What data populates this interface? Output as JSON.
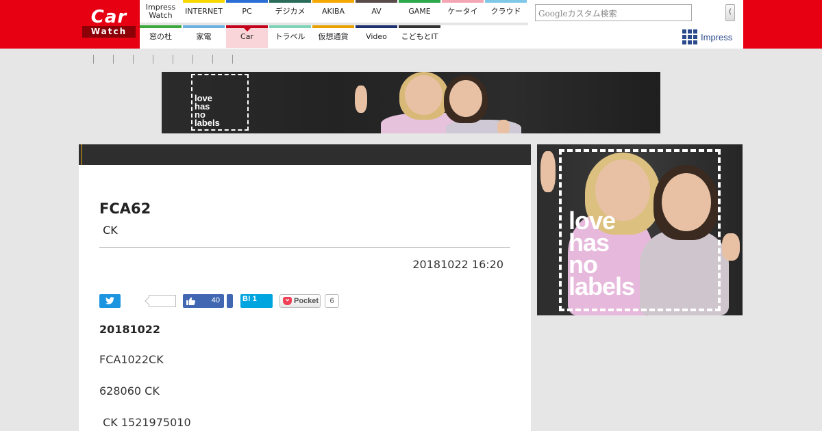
{
  "logo": {
    "car": "Car",
    "watch": "Watch"
  },
  "nav": {
    "row1": [
      {
        "label": "Impress\nWatch",
        "color": ""
      },
      {
        "label": "INTERNET",
        "color": "#f7d900"
      },
      {
        "label": "PC",
        "color": "#2b6fd6"
      },
      {
        "label": "デジカメ",
        "color": "#2a6b5a"
      },
      {
        "label": "AKIBA",
        "color": "#f5a800"
      },
      {
        "label": "AV",
        "color": "#5a4b4b"
      },
      {
        "label": "GAME",
        "color": "#2aa84a"
      },
      {
        "label": "ケータイ",
        "color": "#f4a6b4"
      },
      {
        "label": "クラウド",
        "color": "#7fc8e8"
      }
    ],
    "row2": [
      {
        "label": "窓の杜",
        "color": "#3aa83a"
      },
      {
        "label": "家電",
        "color": "#6ab0e0"
      },
      {
        "label": "Car",
        "color": "#c3001a",
        "active": true
      },
      {
        "label": "トラベル",
        "color": "#7dd4b8"
      },
      {
        "label": "仮想通貨",
        "color": "#e8a000"
      },
      {
        "label": "Video",
        "color": "#1c2f6e"
      },
      {
        "label": "こどもとIT",
        "color": "#333333"
      }
    ]
  },
  "search": {
    "placeholder": "Googleカスタム検索",
    "button": "("
  },
  "impress": {
    "label": "Impress"
  },
  "banner_ad": {
    "text_lines": [
      "love",
      "has",
      "no",
      "labels"
    ]
  },
  "side_ad": {
    "text_lines": [
      "love",
      "has",
      "no",
      "labels"
    ]
  },
  "article": {
    "title": "FCA62",
    "subtitle": " CK",
    "date": "20181022 16:20",
    "social": {
      "facebook_count": "40",
      "hatena_label": "B!",
      "hatena_count": "1",
      "pocket_label": "Pocket",
      "pocket_count": "6"
    },
    "heading": "20181022",
    "paragraphs": [
      "FCA1022CK",
      "628060 CK",
      " CK 1521975010"
    ]
  },
  "colors": {
    "brand_red": "#e60012",
    "twitter": "#1b95e0",
    "facebook": "#4267b2",
    "hatena": "#00a4de",
    "pocket": "#ef4056"
  }
}
